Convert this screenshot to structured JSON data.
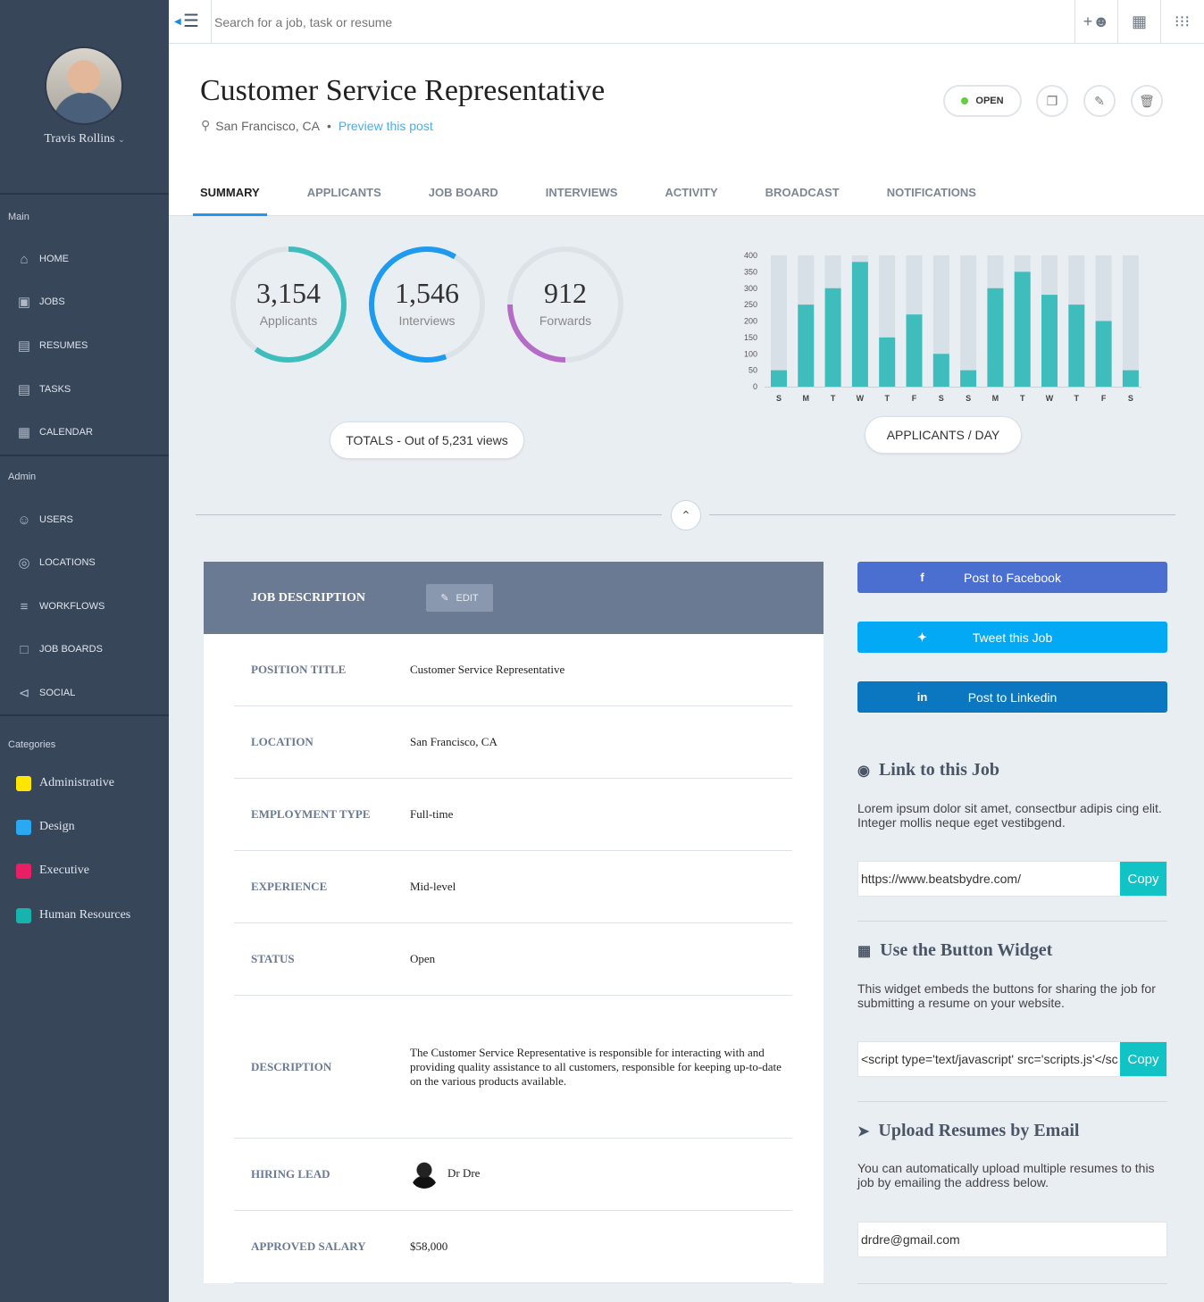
{
  "user": {
    "name": "Travis Rollins"
  },
  "sidebar": {
    "main_label": "Main",
    "main_items": [
      {
        "label": "HOME",
        "icon": "home-icon"
      },
      {
        "label": "JOBS",
        "icon": "briefcase-icon"
      },
      {
        "label": "RESUMES",
        "icon": "document-icon"
      },
      {
        "label": "TASKS",
        "icon": "tasks-icon"
      },
      {
        "label": "CALENDAR",
        "icon": "calendar-icon"
      }
    ],
    "admin_label": "Admin",
    "admin_items": [
      {
        "label": "USERS",
        "icon": "users-icon"
      },
      {
        "label": "LOCATIONS",
        "icon": "location-pin-icon"
      },
      {
        "label": "WORKFLOWS",
        "icon": "workflow-icon"
      },
      {
        "label": "JOB BOARDS",
        "icon": "board-icon"
      },
      {
        "label": "SOCIAL",
        "icon": "share-icon"
      }
    ],
    "categories_label": "Categories",
    "categories": [
      {
        "label": "Administrative",
        "color": "#ffe500"
      },
      {
        "label": "Design",
        "color": "#2aa8f2"
      },
      {
        "label": "Executive",
        "color": "#e91e63"
      },
      {
        "label": "Human Resources",
        "color": "#17b3ad"
      }
    ]
  },
  "search": {
    "placeholder": "Search for a job, task or resume"
  },
  "job": {
    "title": "Customer Service Representative",
    "location": "San Francisco, CA",
    "preview_link": "Preview this post",
    "status": "OPEN"
  },
  "tabs": [
    "SUMMARY",
    "APPLICANTS",
    "JOB BOARD",
    "INTERVIEWS",
    "ACTIVITY",
    "BROADCAST",
    "NOTIFICATIONS"
  ],
  "stats": {
    "applicants": {
      "value": "3,154",
      "label": "Applicants",
      "fraction": 0.6,
      "color": "#3fbdbd"
    },
    "interviews": {
      "value": "1,546",
      "label": "Interviews",
      "fraction": 0.64,
      "color": "#1e9bf0"
    },
    "forwards": {
      "value": "912",
      "label": "Forwards",
      "fraction": 0.25,
      "color": "#b56cc6"
    },
    "totals_label": "TOTALS - Out of 5,231 views"
  },
  "chart_data": {
    "type": "bar",
    "categories": [
      "S",
      "M",
      "T",
      "W",
      "T",
      "F",
      "S",
      "S",
      "M",
      "T",
      "W",
      "T",
      "F",
      "S"
    ],
    "values": [
      50,
      250,
      300,
      380,
      150,
      220,
      100,
      50,
      300,
      350,
      280,
      250,
      200,
      50
    ],
    "ylim": [
      0,
      400
    ],
    "yticks": [
      0,
      50,
      100,
      150,
      200,
      250,
      300,
      350,
      400
    ],
    "bar_color": "#3fbdbd",
    "track_color": "#d6e0e6",
    "label": "APPLICANTS / DAY"
  },
  "job_description": {
    "header": "JOB DESCRIPTION",
    "edit_label": "EDIT",
    "rows": {
      "position": {
        "k": "POSITION TITLE",
        "v": "Customer Service Representative"
      },
      "location": {
        "k": "LOCATION",
        "v": "San Francisco, CA"
      },
      "employment": {
        "k": "EMPLOYMENT TYPE",
        "v": "Full-time"
      },
      "experience": {
        "k": "EXPERIENCE",
        "v": "Mid-level"
      },
      "status": {
        "k": "STATUS",
        "v": "Open"
      },
      "description": {
        "k": "DESCRIPTION",
        "v": "The Customer Service Representative is responsible for interacting with and providing quality assistance to all customers, responsible for keeping up-to-date on the various products available."
      },
      "hiring_lead": {
        "k": "HIRING LEAD",
        "v": "Dr Dre"
      },
      "salary": {
        "k": "APPROVED SALARY",
        "v": "$58,000"
      }
    }
  },
  "share": {
    "facebook": {
      "label": "Post to Facebook",
      "color": "#4a6fd0"
    },
    "twitter": {
      "label": "Tweet this Job",
      "color": "#03a9f4"
    },
    "linkedin": {
      "label": "Post to Linkedin",
      "color": "#0a77c0"
    }
  },
  "link_section": {
    "title": "Link to this Job",
    "text": "Lorem ipsum dolor sit amet, consectbur adipis cing elit. Integer mollis neque eget vestibgend.",
    "url": "https://www.beatsbydre.com/",
    "copy": "Copy"
  },
  "widget_section": {
    "title": "Use the Button Widget",
    "text": "This widget embeds the buttons for sharing the job for submitting a resume on your website.",
    "code": "<script type='text/javascript' src='scripts.js'</sc",
    "copy": "Copy"
  },
  "upload_section": {
    "title": "Upload Resumes by Email",
    "text": "You can automatically upload multiple resumes to this job by emailing the address below.",
    "email": "drdre@gmail.com"
  }
}
